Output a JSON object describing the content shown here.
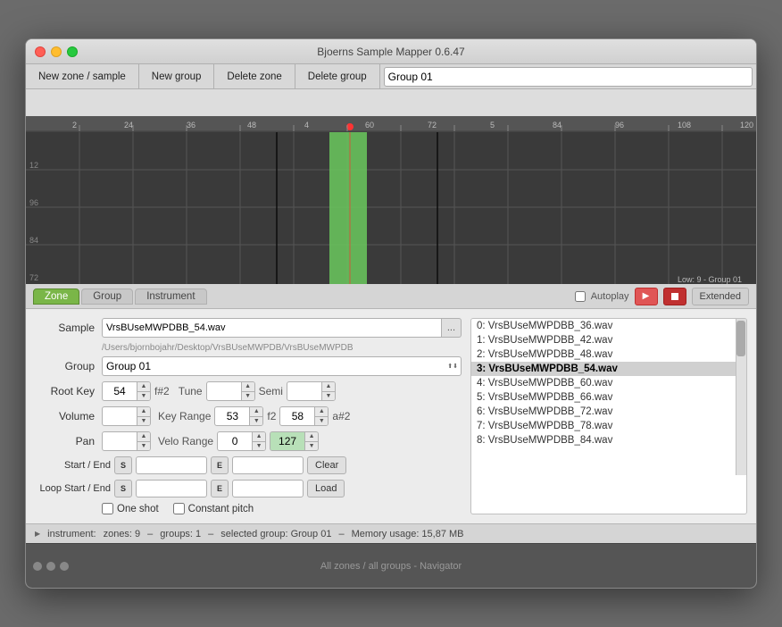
{
  "window": {
    "title": "Bjoerns Sample Mapper 0.6.47"
  },
  "toolbar": {
    "new_zone_label": "New zone / sample",
    "new_group_label": "New group",
    "delete_zone_label": "Delete zone",
    "delete_group_label": "Delete group",
    "group_select_value": "Group 01"
  },
  "tabs": {
    "zone_label": "Zone",
    "group_label": "Group",
    "instrument_label": "Instrument",
    "autoplay_label": "Autoplay",
    "extended_label": "Extended",
    "play_label": "▶",
    "stop_label": "■"
  },
  "zone_panel": {
    "sample_label": "Sample",
    "sample_value": "VrsBUseMWPDBB_54.wav",
    "browse_label": "...",
    "file_path": "/Users/bjornbojahr/Desktop/VrsBUseMWPDB/VrsBUseMWPDB",
    "group_label": "Group",
    "group_value": "Group 01",
    "root_key_label": "Root Key",
    "root_key_value": "54",
    "root_key_note": "f#2",
    "tune_label": "Tune",
    "tune_value": "",
    "semi_label": "Semi",
    "semi_value": "",
    "volume_label": "Volume",
    "volume_value": "",
    "key_range_label": "Key Range",
    "key_range_start": "53",
    "key_range_note": "f2",
    "key_range_end": "58",
    "key_range_end_note": "a#2",
    "pan_label": "Pan",
    "pan_value": "",
    "velo_range_label": "Velo Range",
    "velo_start": "0",
    "velo_end": "127",
    "one_shot_label": "One shot",
    "constant_pitch_label": "Constant pitch",
    "start_end_label": "Start / End",
    "start_btn": "S",
    "end_btn": "E",
    "clear_label": "Clear",
    "loop_start_end_label": "Loop Start / End",
    "loop_start_btn": "S",
    "loop_end_btn": "E",
    "load_label": "Load",
    "zone_label_corner": "Low: 9 - Group 01"
  },
  "sample_list": {
    "items": [
      "0: VrsBUseMWPDBB_36.wav",
      "1: VrsBUseMWPDBB_42.wav",
      "2: VrsBUseMWPDBB_48.wav",
      "3: VrsBUseMWPDBB_54.wav",
      "4: VrsBUseMWPDBB_60.wav",
      "5: VrsBUseMWPDBB_66.wav",
      "6: VrsBUseMWPDBB_72.wav",
      "7: VrsBUseMWPDBB_78.wav",
      "8: VrsBUseMWPDBB_84.wav"
    ],
    "selected_index": 3
  },
  "status_bar": {
    "instrument_label": "instrument:",
    "zones_text": "zones: 9",
    "groups_text": "groups: 1",
    "selected_group": "selected group: Group 01",
    "memory_text": "Memory usage: 15,87 MB"
  },
  "navigator": {
    "title": "All zones / all groups - Navigator"
  }
}
